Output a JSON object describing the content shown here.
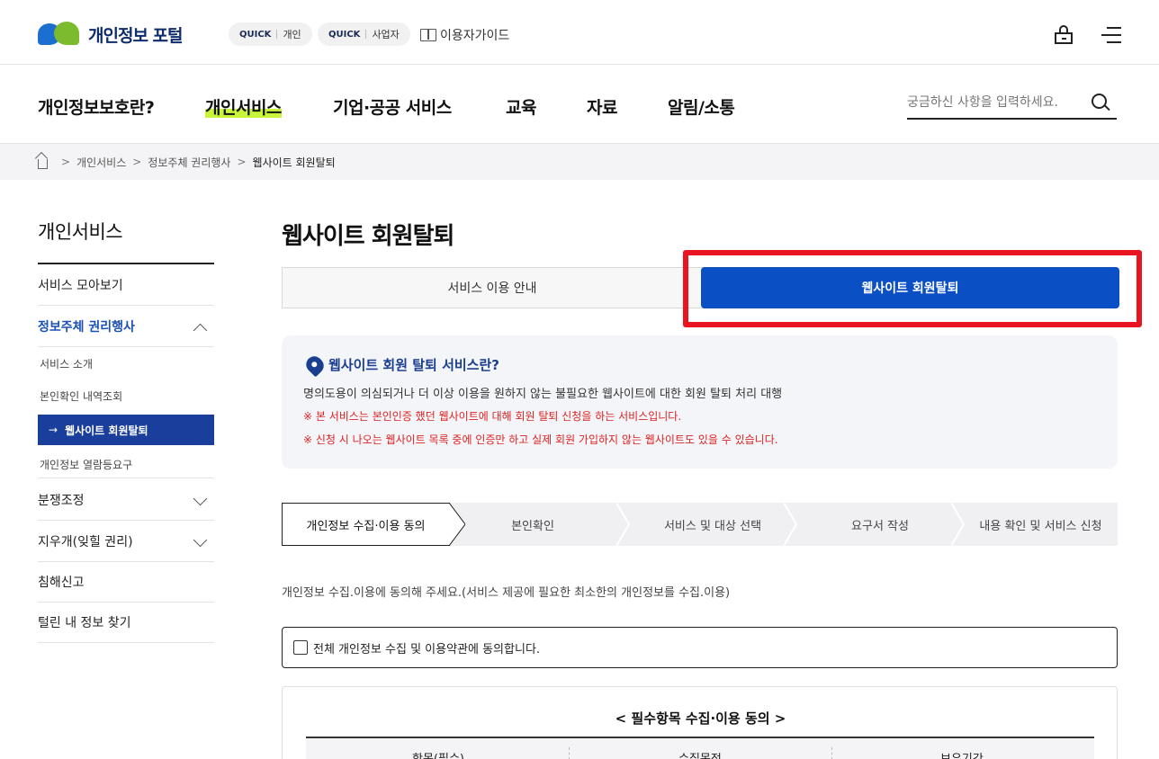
{
  "header": {
    "logo_text": "개인정보 포털",
    "quick_personal": {
      "tag": "QUICK",
      "label": "개인"
    },
    "quick_business": {
      "tag": "QUICK",
      "label": "사업자"
    },
    "guide_label": "이용자가이드"
  },
  "gnb": {
    "items": [
      "개인정보보호란?",
      "개인서비스",
      "기업·공공 서비스",
      "교육",
      "자료",
      "알림/소통"
    ],
    "active": "개인서비스",
    "search_placeholder": "궁금하신 사항을 입력하세요."
  },
  "breadcrumb": [
    "개인서비스",
    "정보주체 권리행사",
    "웹사이트 회원탈퇴"
  ],
  "sidebar": {
    "title": "개인서비스",
    "items": [
      {
        "label": "서비스 모아보기"
      },
      {
        "label": "정보주체 권리행사"
      },
      {
        "label": "분쟁조정"
      },
      {
        "label": "지우개(잊힐 권리)"
      },
      {
        "label": "침해신고"
      },
      {
        "label": "털린 내 정보 찾기"
      }
    ],
    "sub_items": [
      "서비스 소개",
      "본인확인 내역조회",
      "웹사이트 회원탈퇴",
      "개인정보 열람등요구"
    ],
    "sub_active_prefix": "→"
  },
  "main": {
    "title": "웹사이트 회원탈퇴",
    "tabs": [
      "서비스 이용 안내",
      "웹사이트 회원탈퇴"
    ],
    "info": {
      "title": "웹사이트 회원 탈퇴 서비스란?",
      "desc": "명의도용이 의심되거나 더 이상 이용을 원하지 않는 불필요한 웹사이트에 대한 회원 탈퇴 처리 대행",
      "warn1": "※ 본 서비스는 본인인증 했던 웹사이트에 대해 회원 탈퇴 신청을 하는 서비스입니다.",
      "warn2": "※ 신청 시 나오는 웹사이트 목록 중에 인증만 하고 실제 회원 가입하지 않는 웹사이트도 있을 수 있습니다."
    },
    "steps": [
      "개인정보 수집·이용 동의",
      "본인확인",
      "서비스 및 대상 선택",
      "요구서 작성",
      "내용 확인 및 서비스 신청"
    ],
    "consent_text": "개인정보 수집.이용에 동의해 주세요.(서비스 제공에 필요한 최소한의 개인정보를 수집.이용)",
    "agree_all": "전체 개인정보 수집 및 이용약관에 동의합니다.",
    "terms": {
      "title": "< 필수항목 수집·이용 동의 >",
      "columns": [
        "항목(필수)",
        "수집목적",
        "보유기간"
      ]
    }
  },
  "colors": {
    "primary": "#0b4fc4",
    "sidebar_active": "#1a3e9c",
    "highlight": "#c8f53a",
    "annotation": "#e8141f"
  }
}
